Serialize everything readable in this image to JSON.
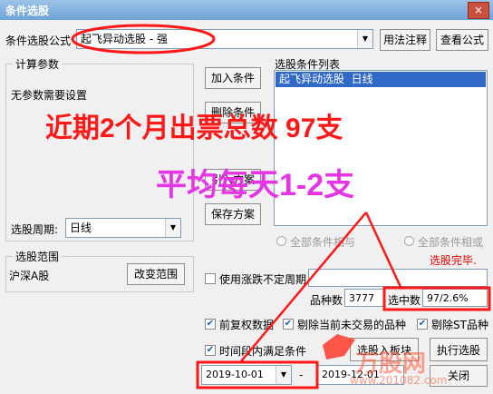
{
  "window": {
    "title": "条件选股",
    "close": "×"
  },
  "formula": {
    "label": "条件选股公式",
    "value": "起飞异动选股 - 强",
    "usage_btn": "用法注释",
    "view_btn": "查看公式"
  },
  "calc_params": {
    "title": "计算参数",
    "no_params": "无参数需要设置"
  },
  "actions": {
    "add": "加入条件",
    "delete": "删除条件",
    "import": "引入方案",
    "save": "保存方案"
  },
  "conditions": {
    "title": "选股条件列表",
    "items": [
      "起飞异动选股  日线"
    ]
  },
  "period": {
    "label": "选股周期:",
    "value": "日线"
  },
  "radios": {
    "all_and": "全部条件相与",
    "all_or": "全部条件相或"
  },
  "status": {
    "done": "选股完毕."
  },
  "range": {
    "title": "选股范围",
    "value": "沪深A股",
    "change_btn": "改变范围"
  },
  "options": {
    "use_uncertain": "使用涨跌不定周期",
    "stock_count_label": "品种数",
    "stock_count": "3777",
    "selected_label": "选中数",
    "selected": "97/2.6%",
    "pre_adjust": "前复权数据",
    "exclude_untraded": "剔除当前未交易的品种",
    "exclude_st": "剔除ST品种",
    "time_range": "时间段内满足条件"
  },
  "dates": {
    "start": "2019-10-01",
    "end": "2019-12-01",
    "separator": "-"
  },
  "bottom_buttons": {
    "to_board": "选股入板块",
    "execute": "执行选股",
    "close": "关闭"
  },
  "overlays": {
    "line1": "近期2个月出票总数 97支",
    "line2": "平均每天1-2支",
    "watermark": "万股网",
    "watermark_url": "www.201082.com"
  },
  "colors": {
    "accent_red": "#ff1818",
    "accent_magenta": "#e535e5",
    "selection": "#3169c6"
  }
}
